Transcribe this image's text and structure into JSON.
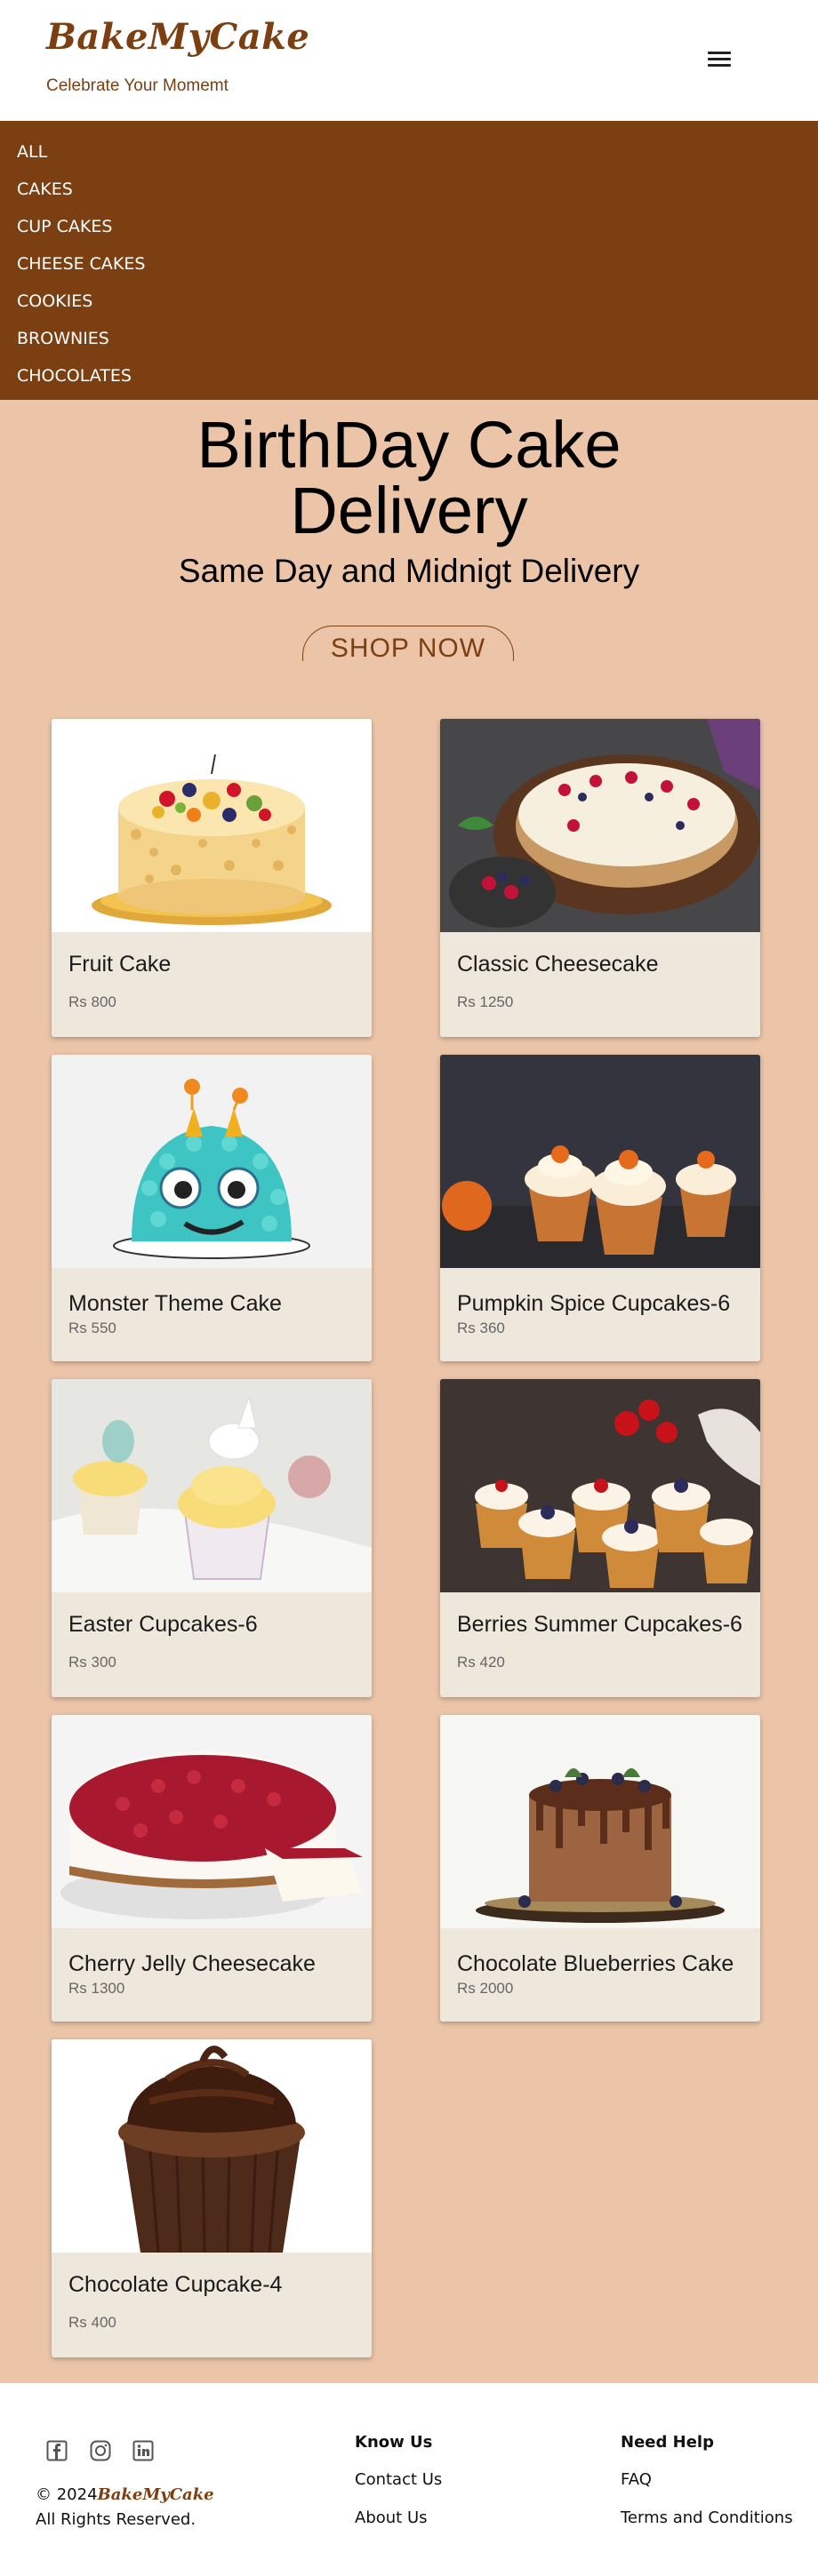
{
  "brand": {
    "name": "BakeMyCake",
    "tagline": "Celebrate Your Momemt"
  },
  "nav": {
    "items": [
      "ALL",
      "CAKES",
      "CUP CAKES",
      "CHEESE CAKES",
      "COOKIES",
      "BROWNIES",
      "CHOCOLATES"
    ]
  },
  "hero": {
    "title": "BirthDay Cake Delivery",
    "subtitle": "Same Day and Midnigt Delivery",
    "cta": "SHOP NOW"
  },
  "products": [
    {
      "name": "Fruit Cake",
      "price": "Rs 800"
    },
    {
      "name": "Classic Cheesecake",
      "price": "Rs 1250"
    },
    {
      "name": "Monster Theme Cake",
      "price": "Rs 550"
    },
    {
      "name": "Pumpkin Spice Cupcakes-6",
      "price": "Rs 360"
    },
    {
      "name": "Easter Cupcakes-6",
      "price": "Rs 300"
    },
    {
      "name": "Berries Summer Cupcakes-6",
      "price": "Rs 420"
    },
    {
      "name": "Cherry Jelly Cheesecake",
      "price": "Rs 1300"
    },
    {
      "name": "Chocolate Blueberries Cake",
      "price": "Rs 2000"
    },
    {
      "name": "Chocolate Cupcake-4",
      "price": "Rs 400"
    }
  ],
  "footer": {
    "social_icons": [
      "facebook-icon",
      "instagram-icon",
      "linkedin-icon"
    ],
    "copyright_prefix": "© 2024",
    "copyright_brand": "BakeMyCake",
    "rights": "All Rights Reserved.",
    "col1_heading": "Know Us",
    "col1_links": [
      "Contact Us",
      "About Us"
    ],
    "col2_heading": "Need Help",
    "col2_links": [
      "FAQ",
      "Terms and Conditions"
    ]
  },
  "colors": {
    "brand": "#7b3f12",
    "hero_bg": "#ecc5a9",
    "card_bg": "#eee8dc"
  }
}
